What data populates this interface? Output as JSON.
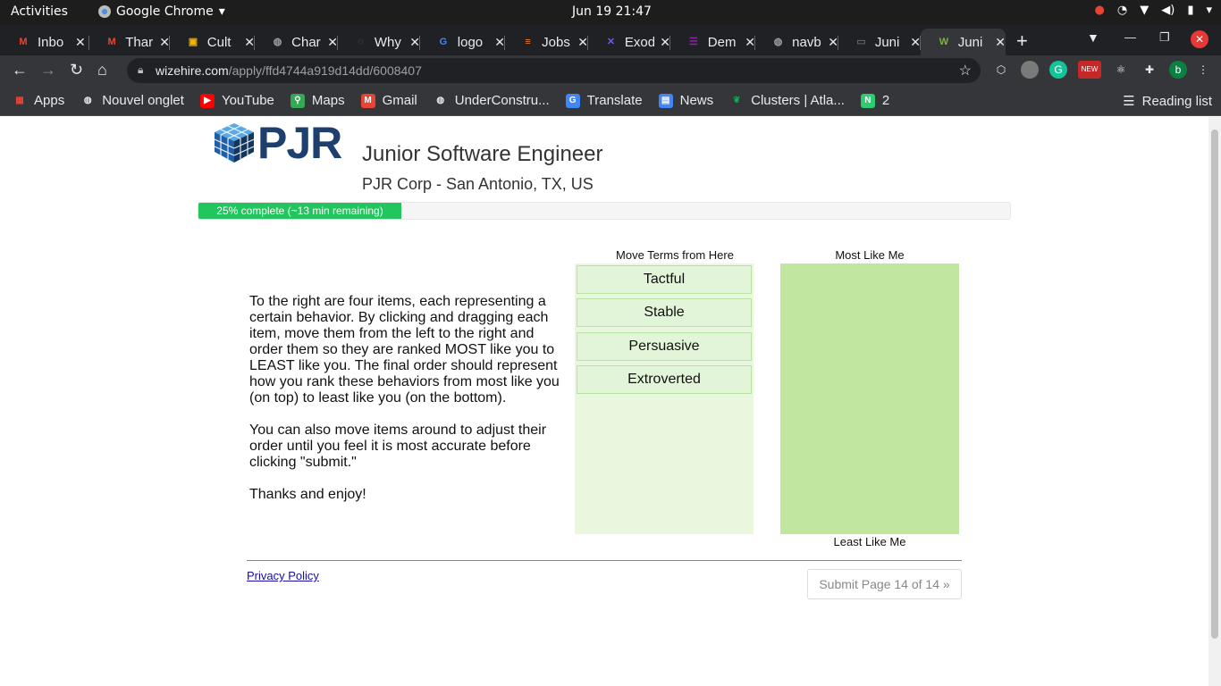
{
  "system_bar": {
    "activities": "Activities",
    "app_name": "Google Chrome",
    "clock": "Jun 19  21:47"
  },
  "tabs": [
    {
      "title": "Inbo",
      "favicon": "gmail-icon",
      "color": "#ea4335",
      "glyph": "M"
    },
    {
      "title": "Thar",
      "favicon": "gmail-icon",
      "color": "#ea4335",
      "glyph": "M"
    },
    {
      "title": "Cult",
      "favicon": "slides-icon",
      "color": "#f4b400",
      "glyph": "▣"
    },
    {
      "title": "Char",
      "favicon": "globe-icon",
      "color": "#9aa0a6",
      "glyph": "◍"
    },
    {
      "title": "Why",
      "favicon": "loading-icon",
      "color": "#5f6368",
      "glyph": "◌"
    },
    {
      "title": "logo",
      "favicon": "google-icon",
      "color": "#4285f4",
      "glyph": "G"
    },
    {
      "title": "Jobs",
      "favicon": "stackoverflow-icon",
      "color": "#f48024",
      "glyph": "≡"
    },
    {
      "title": "Exod",
      "favicon": "exodus-icon",
      "color": "#6c5ce7",
      "glyph": "✕"
    },
    {
      "title": "Dem",
      "favicon": "list-icon",
      "color": "#8e24aa",
      "glyph": "☰"
    },
    {
      "title": "navb",
      "favicon": "globe-icon",
      "color": "#9aa0a6",
      "glyph": "◍"
    },
    {
      "title": "Juni",
      "favicon": "page-icon",
      "color": "#5f6368",
      "glyph": "▭"
    },
    {
      "title": "Juni",
      "favicon": "wizehire-icon",
      "color": "#7cb342",
      "glyph": "W",
      "active": true
    }
  ],
  "toolbar": {
    "url_host": "wizehire.com",
    "url_path": "/apply/ffd4744a919d14dd/6008407",
    "profile_initial": "b",
    "new_badge": "NEW"
  },
  "bookmarks": [
    {
      "label": "Apps",
      "icon": "apps-grid-icon",
      "color": "#ea4335"
    },
    {
      "label": "Nouvel onglet",
      "icon": "globe-icon",
      "color": "#9aa0a6"
    },
    {
      "label": "YouTube",
      "icon": "youtube-icon",
      "color": "#ff0000"
    },
    {
      "label": "Maps",
      "icon": "maps-icon",
      "color": "#34a853"
    },
    {
      "label": "Gmail",
      "icon": "gmail-icon",
      "color": "#ea4335"
    },
    {
      "label": "UnderConstru...",
      "icon": "globe-icon",
      "color": "#9aa0a6"
    },
    {
      "label": "Translate",
      "icon": "translate-icon",
      "color": "#4285f4"
    },
    {
      "label": "News",
      "icon": "news-icon",
      "color": "#4285f4"
    },
    {
      "label": "Clusters | Atla...",
      "icon": "mongodb-leaf-icon",
      "color": "#13aa52"
    },
    {
      "label": "2",
      "icon": "notion-n-icon",
      "color": "#2ecc71"
    }
  ],
  "reading_list": "Reading list",
  "page": {
    "logo_text": "PJR",
    "job_title": "Junior Software Engineer",
    "company_location": "PJR Corp - San Antonio, TX, US",
    "progress_label": "25% complete (~13 min remaining)",
    "progress_percent": 25,
    "instructions": [
      "To the right are four items, each representing a certain behavior. By clicking and dragging each item, move them from the left to the right and order them so they are ranked MOST like you to LEAST like you. The final order should represent how you rank these behaviors from most like you (on top) to least like you (on the bottom).",
      "You can also move items around to adjust their order until you feel it is most accurate before clicking \"submit.\"",
      "Thanks and enjoy!"
    ],
    "source_label": "Move Terms from Here",
    "target_top_label": "Most Like Me",
    "target_bottom_label": "Least Like Me",
    "items": [
      "Tactful",
      "Stable",
      "Persuasive",
      "Extroverted"
    ],
    "privacy_link": "Privacy Policy",
    "submit_label": "Submit Page 14 of 14 »"
  }
}
